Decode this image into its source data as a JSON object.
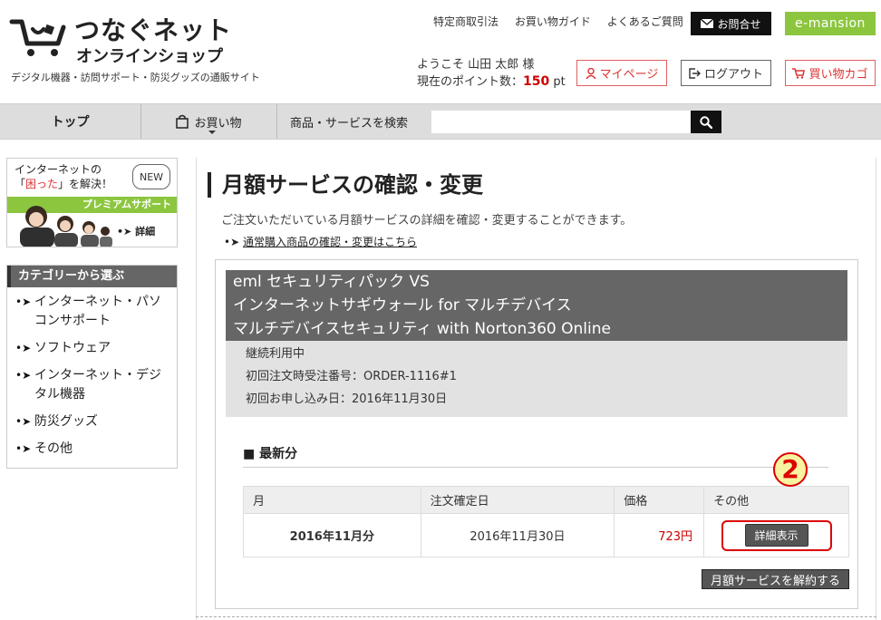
{
  "header": {
    "logo_title": "つなぐネット",
    "logo_sub": "オンラインショップ",
    "tagline": "デジタル機器・訪問サポート・防災グッズの通販サイト",
    "top_links": [
      "特定商取引法",
      "お買い物ガイド",
      "よくあるご質問"
    ],
    "contact_label": "お問合せ",
    "emansion_label": "e-mansion",
    "welcome": "ようこそ 山田 太郎 様",
    "points_label": "現在のポイント数：",
    "points_value": "150",
    "points_unit": "pt",
    "mypage_label": "マイページ",
    "logout_label": "ログアウト",
    "cart_label": "買い物カゴ"
  },
  "nav": {
    "top_label": "トップ",
    "shop_label": "お買い物",
    "search_label": "商品・サービスを検索",
    "search_placeholder": ""
  },
  "sidebar": {
    "promo_line1": "インターネットの",
    "promo_line2_pre": "「",
    "promo_line2_red": "困った",
    "promo_line2_post": "」を解決！",
    "promo_new": "NEW",
    "promo_band": "プレミアムサポート",
    "promo_detail": "詳細",
    "category_head": "カテゴリーから選ぶ",
    "categories": [
      "インターネット・パソコンサポート",
      "ソフトウェア",
      "インターネット・デジタル機器",
      "防災グッズ",
      "その他"
    ]
  },
  "main": {
    "title": "月額サービスの確認・変更",
    "desc": "ご注文いただいている月額サービスの詳細を確認・変更することができます。",
    "link": "通常購入商品の確認・変更はこちら",
    "service": {
      "name_lines": [
        "eml セキュリティパック VS",
        "インターネットサギウォール for マルチデバイス",
        "マルチデバイスセキュリティ with Norton360 Online"
      ],
      "status": "継続利用中",
      "order_no": "初回注文時受注番号：ORDER-1116#1",
      "apply_date": "初回お申し込み日：2016年11月30日"
    },
    "latest_title": "最新分",
    "table": {
      "headers": [
        "月",
        "注文確定日",
        "価格",
        "その他"
      ],
      "rows": [
        {
          "month": "2016年11月分",
          "date": "2016年11月30日",
          "price": "723円",
          "action": "詳細表示"
        }
      ]
    },
    "callout_number": "2",
    "cancel_label": "月額サービスを解約する"
  }
}
